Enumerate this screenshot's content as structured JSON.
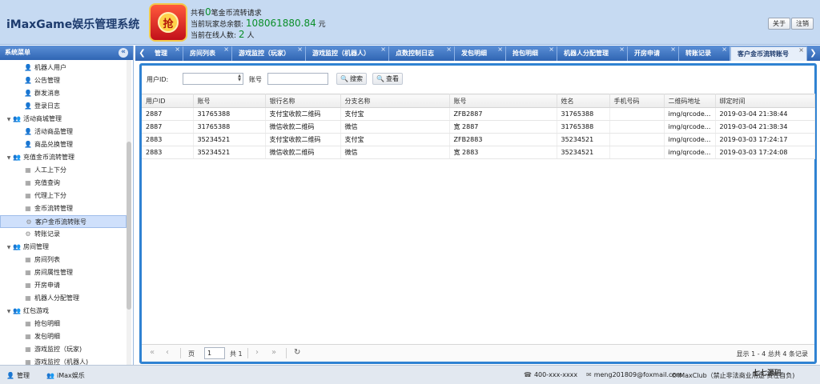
{
  "app": {
    "title": "iMaxGame娱乐管理系统"
  },
  "notice": {
    "line1_prefix": "共有",
    "line1_count": "0",
    "line1_suffix": "笔金币流转请求",
    "line2_prefix": "当前玩家总余额:",
    "line2_amount": "108061880.84",
    "line2_unit": "元",
    "line3_prefix": "当前在线人数:",
    "line3_count": "2",
    "line3_unit": "人",
    "logo_char": "抢"
  },
  "header_buttons": {
    "about": "关于",
    "logout": "注销"
  },
  "sidebar": {
    "title": "系统菜单",
    "collapse_icon": "«",
    "items": [
      {
        "label": "机器人用户"
      },
      {
        "label": "公告管理"
      },
      {
        "label": "群发消息"
      },
      {
        "label": "登录日志"
      },
      {
        "label": "活动商城管理"
      },
      {
        "label": "活动商品管理"
      },
      {
        "label": "商品兑换管理"
      },
      {
        "label": "充值金币流转管理"
      },
      {
        "label": "人工上下分"
      },
      {
        "label": "充值查询"
      },
      {
        "label": "代理上下分"
      },
      {
        "label": "金币流转管理"
      },
      {
        "label": "客户金币流转账号"
      },
      {
        "label": "转账记录"
      },
      {
        "label": "房间管理"
      },
      {
        "label": "房间列表"
      },
      {
        "label": "房间属性管理"
      },
      {
        "label": "开房申请"
      },
      {
        "label": "机器人分配管理"
      },
      {
        "label": "红包游戏"
      },
      {
        "label": "抢包明细"
      },
      {
        "label": "发包明细"
      },
      {
        "label": "游戏监控（玩家)"
      },
      {
        "label": "游戏监控（机器人)"
      }
    ]
  },
  "tabs": [
    {
      "label": "管理"
    },
    {
      "label": "房间列表"
    },
    {
      "label": "游戏监控（玩家）"
    },
    {
      "label": "游戏监控（机器人）"
    },
    {
      "label": "点数控制日志"
    },
    {
      "label": "发包明细"
    },
    {
      "label": "抢包明细"
    },
    {
      "label": "机器人分配管理"
    },
    {
      "label": "开房申请"
    },
    {
      "label": "转账记录"
    },
    {
      "label": "客户金币流转账号"
    }
  ],
  "search": {
    "user_id_label": "用户ID:",
    "account_label": "账号",
    "search_button": "搜索",
    "view_button": "查看"
  },
  "table": {
    "columns": [
      "用户ID",
      "账号",
      "银行名称",
      "分支名称",
      "账号",
      "姓名",
      "手机号码",
      "二维码地址",
      "绑定时间"
    ],
    "rows": [
      [
        "2887",
        "31765388",
        "支付宝收款二维码",
        "支付宝",
        "ZFB2887",
        "31765388",
        "",
        "img/qrcode...",
        "2019-03-04 21:38:44"
      ],
      [
        "2887",
        "31765388",
        "微信收款二维码",
        "微信",
        "宽 2887",
        "31765388",
        "",
        "img/qrcode...",
        "2019-03-04 21:38:34"
      ],
      [
        "2883",
        "35234521",
        "支付宝收款二维码",
        "支付宝",
        "ZFB2883",
        "35234521",
        "",
        "img/qrcode...",
        "2019-03-03 17:24:17"
      ],
      [
        "2883",
        "35234521",
        "微信收款二维码",
        "微信",
        "宽 2883",
        "35234521",
        "",
        "img/qrcode...",
        "2019-03-03 17:24:08"
      ]
    ]
  },
  "pager": {
    "page_label": "页",
    "page_value": "1",
    "total_label": "共 1",
    "info": "显示 1 - 4 总共 4 条记录"
  },
  "footer": {
    "user": "管理",
    "company": "iMax娱乐",
    "phone": "400-xxx-xxxx",
    "email": "meng201809@foxmail.com",
    "copyright": "©iMaxClub（禁止非法商业用途 责任自负)"
  },
  "watermark": "七七源码"
}
